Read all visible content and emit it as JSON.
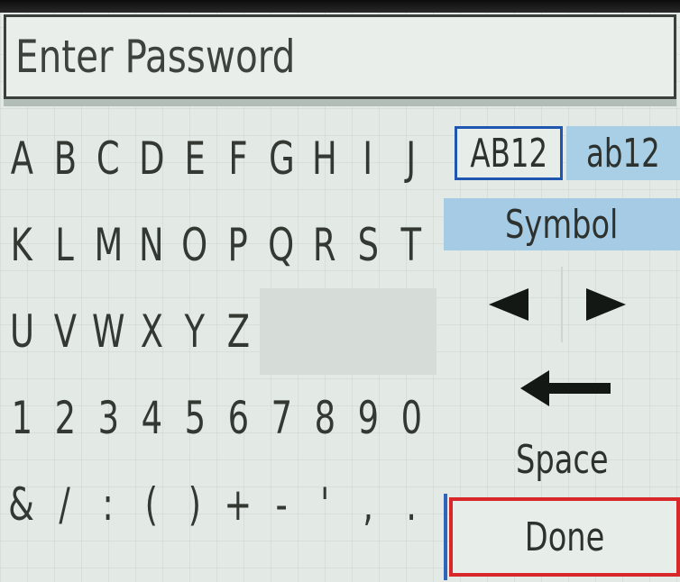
{
  "title": "Enter Password",
  "keyboard": {
    "rows": [
      [
        "A",
        "B",
        "C",
        "D",
        "E",
        "F",
        "G",
        "H",
        "I",
        "J"
      ],
      [
        "K",
        "L",
        "M",
        "N",
        "O",
        "P",
        "Q",
        "R",
        "S",
        "T"
      ],
      [
        "U",
        "V",
        "W",
        "X",
        "Y",
        "Z"
      ],
      [
        "1",
        "2",
        "3",
        "4",
        "5",
        "6",
        "7",
        "8",
        "9",
        "0"
      ],
      [
        "&",
        "/",
        ":",
        "(",
        ")",
        "+",
        "-",
        "'",
        ",",
        "."
      ]
    ]
  },
  "side": {
    "mode_upper": "AB12",
    "mode_lower": "ab12",
    "symbol": "Symbol",
    "cursor_left_icon": "triangle-left-icon",
    "cursor_right_icon": "triangle-right-icon",
    "backspace_icon": "backspace-arrow-icon",
    "space": "Space",
    "done": "Done"
  },
  "colors": {
    "selected_mode_border": "#1f56b0",
    "highlight_blue": "#a6cce5",
    "done_border": "#d8282a",
    "text": "#2d322e"
  }
}
